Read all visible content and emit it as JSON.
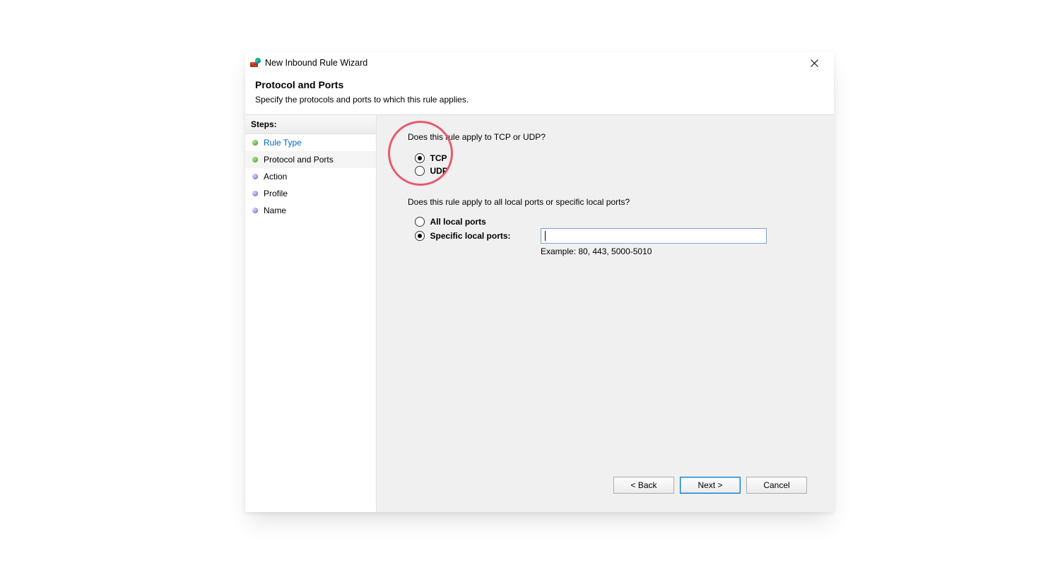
{
  "window": {
    "title": "New Inbound Rule Wizard"
  },
  "header": {
    "title": "Protocol and Ports",
    "subtitle": "Specify the protocols and ports to which this rule applies."
  },
  "sidebar": {
    "header": "Steps:",
    "steps": [
      {
        "label": "Rule Type",
        "state": "done",
        "link": true
      },
      {
        "label": "Protocol and Ports",
        "state": "done",
        "current": true
      },
      {
        "label": "Action",
        "state": "pending"
      },
      {
        "label": "Profile",
        "state": "pending"
      },
      {
        "label": "Name",
        "state": "pending"
      }
    ]
  },
  "main": {
    "protocol_prompt": "Does this rule apply to TCP or UDP?",
    "protocol_options": {
      "tcp": "TCP",
      "udp": "UDP",
      "selected": "tcp"
    },
    "ports_prompt": "Does this rule apply to all local ports or specific local ports?",
    "ports_options": {
      "all": "All local ports",
      "specific": "Specific local ports:",
      "selected": "specific"
    },
    "ports_input": {
      "value": "",
      "example": "Example: 80, 443, 5000-5010"
    }
  },
  "footer": {
    "back": "< Back",
    "next": "Next >",
    "cancel": "Cancel"
  }
}
